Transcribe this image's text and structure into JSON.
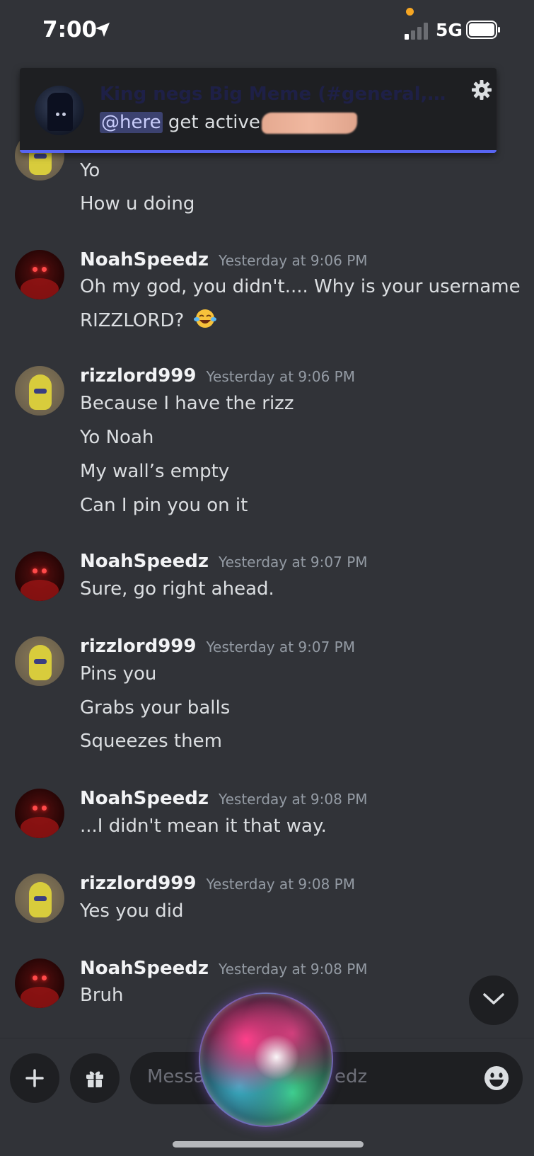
{
  "status_bar": {
    "time": "7:00",
    "network": "5G",
    "icons": [
      "location-arrow-icon",
      "cellular-signal-icon",
      "battery-icon"
    ]
  },
  "notification": {
    "title": "King negs Big Meme (#general, Shark...",
    "mention": "@here",
    "body": "get active",
    "icons": [
      "gear-icon"
    ]
  },
  "messages": [
    {
      "lines": [
        "Yo",
        "How u doing"
      ]
    },
    {
      "author": "NoahSpeedz",
      "timestamp": "Yesterday at 9:06 PM",
      "lines": [
        "Oh my god, you didn't.... Why is your username",
        "RIZZLORD?"
      ],
      "emoji": "face-with-tears-of-joy"
    },
    {
      "author": "rizzlord999",
      "timestamp": "Yesterday at 9:06 PM",
      "lines": [
        "Because I have the rizz",
        "Yo Noah",
        "My wall’s empty",
        "Can I pin you on it"
      ]
    },
    {
      "author": "NoahSpeedz",
      "timestamp": "Yesterday at 9:07 PM",
      "lines": [
        "Sure, go right ahead."
      ]
    },
    {
      "author": "rizzlord999",
      "timestamp": "Yesterday at 9:07 PM",
      "lines": [
        "Pins you",
        "Grabs your balls",
        "Squeezes them"
      ]
    },
    {
      "author": "NoahSpeedz",
      "timestamp": "Yesterday at 9:08 PM",
      "lines": [
        "...I didn't mean it that way."
      ]
    },
    {
      "author": "rizzlord999",
      "timestamp": "Yesterday at 9:08 PM",
      "lines": [
        "Yes you did"
      ]
    },
    {
      "author": "NoahSpeedz",
      "timestamp": "Yesterday at 9:08 PM",
      "lines": [
        "Bruh"
      ]
    }
  ],
  "composer": {
    "placeholder_start": "Messa",
    "placeholder_end": "edz",
    "icons": [
      "plus-icon",
      "gift-icon",
      "emoji-icon"
    ]
  },
  "scroll_button": {
    "icon": "chevron-down-icon"
  },
  "colors": {
    "background": "#313338",
    "banner": "#1e1f22",
    "accent": "#5865f2",
    "mention_bg": "#3c4270",
    "text": "#dbdee1",
    "muted": "#949ba4"
  }
}
